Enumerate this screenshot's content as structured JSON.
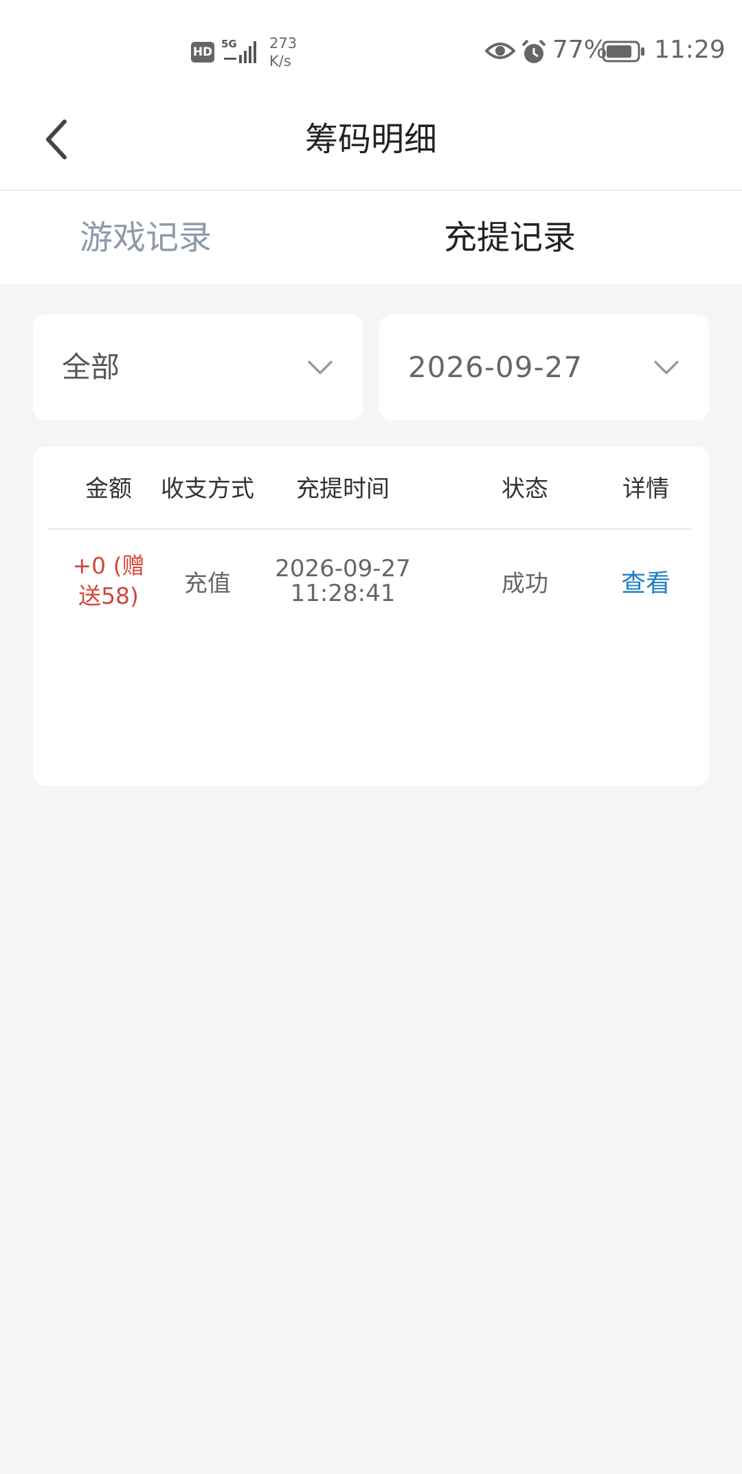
{
  "status_bar": {
    "hd": "HD",
    "network": "5G",
    "speed_value": "273",
    "speed_unit": "K/s",
    "battery": "77%",
    "time": "11:29"
  },
  "header": {
    "title": "筹码明细"
  },
  "tabs": [
    {
      "label": "游戏记录",
      "active": false
    },
    {
      "label": "充提记录",
      "active": true
    }
  ],
  "filters": {
    "type": "全部",
    "date": "2026-09-27"
  },
  "table": {
    "headers": [
      "金额",
      "收支方式",
      "充提时间",
      "状态",
      "详情"
    ],
    "rows": [
      {
        "amount_line1": "+0 (赠",
        "amount_line2": "送58)",
        "method": "充值",
        "date": "2026-09-27",
        "time": "11:28:41",
        "status": "成功",
        "detail": "查看"
      }
    ]
  },
  "colors": {
    "background": "#f5f5f5",
    "amount": "#d6453c",
    "link": "#1d7fc2",
    "inactive_tab": "#8e9aaa"
  }
}
